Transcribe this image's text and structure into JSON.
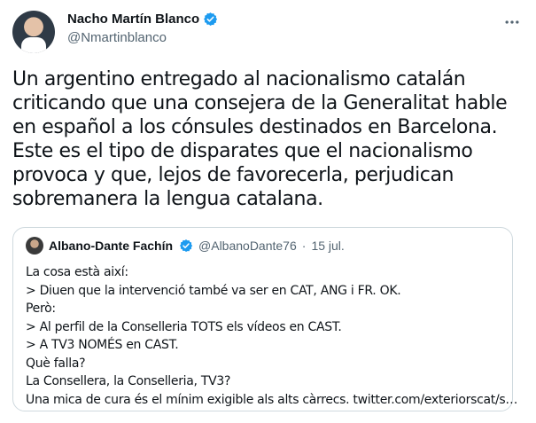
{
  "author": {
    "display_name": "Nacho Martín Blanco",
    "handle": "@Nmartinblanco",
    "verified_icon": "verified-badge-icon"
  },
  "tweet_text": "Un argentino entregado al nacionalismo catalán criticando que una consejera de la Generalitat hable en español a los cónsules destinados en Barcelona. Este es el tipo de disparates que el nacionalismo provoca y que, lejos de favorecerla, perjudican sobremanera la lengua catalana.",
  "quoted_tweet": {
    "display_name": "Albano-Dante Fachín",
    "handle": "@AlbanoDante76",
    "separator": "·",
    "date": "15 jul.",
    "lines": [
      "La cosa està així:",
      "> Diuen que la intervenció també va ser en CAT, ANG i FR. OK.",
      "Però:",
      "> Al perfil de la Conselleria TOTS els vídeos en CAST.",
      "> A TV3 NOMÉS en CAST.",
      "Què falla?",
      "La Consellera, la Conselleria, TV3?",
      "Una mica de cura és el mínim exigible als alts càrrecs. twitter.com/exteriorscat/s…"
    ]
  },
  "colors": {
    "text": "#0f1419",
    "secondary": "#536471",
    "verified": "#1d9bf0",
    "border": "#cfd9de"
  }
}
